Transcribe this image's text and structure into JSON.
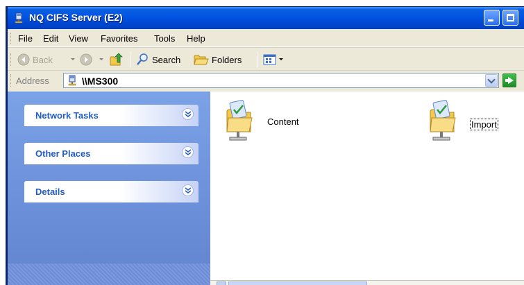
{
  "window": {
    "title": "NQ CIFS Server (E2)"
  },
  "menubar": {
    "items": [
      "File",
      "Edit",
      "View",
      "Favorites",
      "Tools",
      "Help"
    ]
  },
  "toolbar": {
    "back_label": "Back",
    "search_label": "Search",
    "folders_label": "Folders"
  },
  "address": {
    "label": "Address",
    "value": "\\\\MS300"
  },
  "tasks": {
    "groups": [
      "Network Tasks",
      "Other Places",
      "Details"
    ]
  },
  "files": {
    "items": [
      {
        "name": "Content",
        "selected": false
      },
      {
        "name": "Import",
        "selected": true
      }
    ]
  },
  "colors": {
    "title_bar": "#0054e3",
    "task_pane": "#7ba2e7",
    "task_label": "#215dc6",
    "go_button": "#1e8a28"
  }
}
